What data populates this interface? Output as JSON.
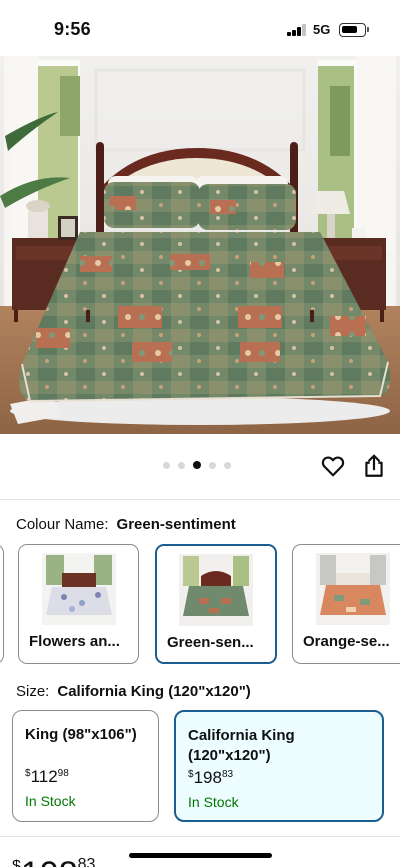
{
  "status_bar": {
    "time": "9:56",
    "network": "5G",
    "icons": [
      "signal-icon",
      "battery-icon"
    ]
  },
  "product_image": {
    "alt": "Green-sentiment patchwork quilt bedspread set on bed"
  },
  "carousel": {
    "dot_count": 5,
    "active_index": 2
  },
  "actions": {
    "icons": [
      "heart-icon",
      "share-icon"
    ]
  },
  "colour": {
    "label": "Colour Name:",
    "selected": "Green-sentiment",
    "options": [
      {
        "label": "Flowers an..."
      },
      {
        "label": "Green-sen..."
      },
      {
        "label": "Orange-se..."
      }
    ]
  },
  "size": {
    "label": "Size:",
    "selected": "California King (120\"x120\")",
    "options": [
      {
        "name": "King (98\"x106\")",
        "price_symbol": "$",
        "price_whole": "112",
        "price_fraction": "98",
        "stock": "In Stock"
      },
      {
        "name_line1": "California King",
        "name_line2": "(120\"x120\")",
        "price_symbol": "$",
        "price_whole": "198",
        "price_fraction": "83",
        "stock": "In Stock"
      }
    ]
  },
  "bottom_price": {
    "symbol": "$",
    "whole": "198",
    "fraction": "83"
  },
  "colors": {
    "selected_border": "#1c5d92",
    "selected_bg": "#edfdff",
    "in_stock": "#007600",
    "quilt_green": "#6f8a6c"
  }
}
